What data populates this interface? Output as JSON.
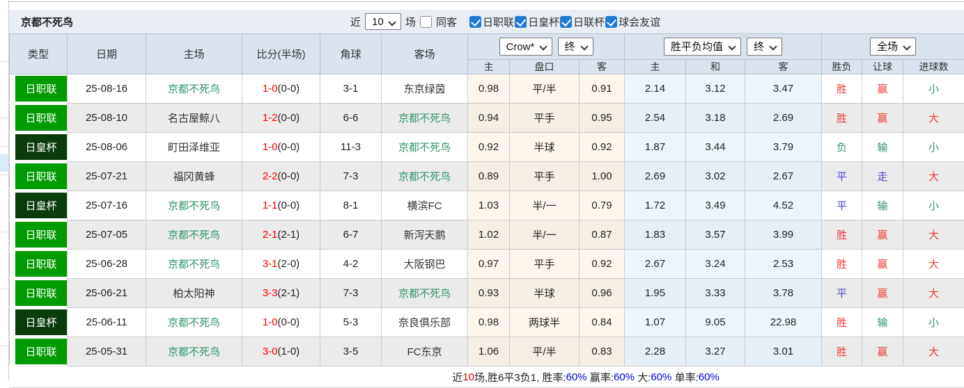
{
  "colors": {
    "accent_check": "#1f7ad4",
    "league_green": "#009b00",
    "cup_dark_green": "#0a3d0a",
    "self_team_green": "#2f9469",
    "score_red": "#ff0000",
    "win_red": "#f03b3b",
    "draw_blue": "#4a4ad4",
    "loss_green": "#2f9469",
    "footer_blue": "#0000dd"
  },
  "title": {
    "team": "京都不死鸟"
  },
  "filter_bar": {
    "near_label": "近",
    "matches_value": "10",
    "matches_label": "场",
    "same_away": {
      "label": "同客",
      "checked": false
    },
    "leagues": [
      {
        "label": "日职联",
        "checked": true
      },
      {
        "label": "日皇杯",
        "checked": true
      },
      {
        "label": "日联杯",
        "checked": true
      },
      {
        "label": "球会友谊",
        "checked": true
      }
    ]
  },
  "table": {
    "col_type": "类型",
    "col_date": "日期",
    "col_home": "主场",
    "col_score": "比分(半场)",
    "col_corner": "角球",
    "col_away": "客场",
    "odds_group": {
      "bookmaker_value": "Crow*",
      "time_value": "终",
      "sub": [
        "主",
        "盘口",
        "客"
      ]
    },
    "avg_group": {
      "name_value": "胜平负均值",
      "time_value": "终",
      "sub": [
        "主",
        "和",
        "客"
      ]
    },
    "result_group": {
      "scope_value": "全场",
      "sub": [
        "胜负",
        "让球",
        "进球数"
      ]
    },
    "rows": [
      {
        "league": "日职联",
        "league_tone": "jleague",
        "date": "25-08-16",
        "home": "京都不死鸟",
        "home_self": true,
        "score": "1-0",
        "half": "(0-0)",
        "corner": "3-1",
        "away": "东京绿茵",
        "away_self": false,
        "odds": [
          "0.98",
          "平/半",
          "0.91"
        ],
        "avg": [
          "2.14",
          "3.12",
          "3.47"
        ],
        "results": [
          {
            "text": "胜",
            "tone": "red"
          },
          {
            "text": "赢",
            "tone": "red"
          },
          {
            "text": "小",
            "tone": "green"
          }
        ]
      },
      {
        "league": "日职联",
        "league_tone": "jleague",
        "date": "25-08-10",
        "home": "名古屋鲸八",
        "home_self": false,
        "score": "1-2",
        "half": "(0-0)",
        "corner": "6-6",
        "away": "京都不死鸟",
        "away_self": true,
        "odds": [
          "0.94",
          "平手",
          "0.95"
        ],
        "avg": [
          "2.54",
          "3.18",
          "2.69"
        ],
        "results": [
          {
            "text": "胜",
            "tone": "red"
          },
          {
            "text": "赢",
            "tone": "red"
          },
          {
            "text": "大",
            "tone": "red"
          }
        ]
      },
      {
        "league": "日皇杯",
        "league_tone": "empcup",
        "date": "25-08-06",
        "home": "町田泽维亚",
        "home_self": false,
        "score": "1-0",
        "half": "(0-0)",
        "corner": "11-3",
        "away": "京都不死鸟",
        "away_self": true,
        "odds": [
          "0.92",
          "半球",
          "0.92"
        ],
        "avg": [
          "1.87",
          "3.44",
          "3.79"
        ],
        "results": [
          {
            "text": "负",
            "tone": "green"
          },
          {
            "text": "输",
            "tone": "green"
          },
          {
            "text": "小",
            "tone": "green"
          }
        ]
      },
      {
        "league": "日职联",
        "league_tone": "jleague",
        "date": "25-07-21",
        "home": "福冈黄蜂",
        "home_self": false,
        "score": "2-2",
        "half": "(0-0)",
        "corner": "7-3",
        "away": "京都不死鸟",
        "away_self": true,
        "odds": [
          "0.89",
          "平手",
          "1.00"
        ],
        "avg": [
          "2.69",
          "3.02",
          "2.67"
        ],
        "results": [
          {
            "text": "平",
            "tone": "blue"
          },
          {
            "text": "走",
            "tone": "blue"
          },
          {
            "text": "大",
            "tone": "red"
          }
        ]
      },
      {
        "league": "日皇杯",
        "league_tone": "empcup",
        "date": "25-07-16",
        "home": "京都不死鸟",
        "home_self": true,
        "score": "1-1",
        "half": "(0-0)",
        "corner": "8-1",
        "away": "横滨FC",
        "away_self": false,
        "odds": [
          "1.03",
          "半/一",
          "0.79"
        ],
        "avg": [
          "1.72",
          "3.49",
          "4.52"
        ],
        "results": [
          {
            "text": "平",
            "tone": "blue"
          },
          {
            "text": "输",
            "tone": "green"
          },
          {
            "text": "小",
            "tone": "green"
          }
        ]
      },
      {
        "league": "日职联",
        "league_tone": "jleague",
        "date": "25-07-05",
        "home": "京都不死鸟",
        "home_self": true,
        "score": "2-1",
        "half": "(2-1)",
        "corner": "6-7",
        "away": "新泻天鹅",
        "away_self": false,
        "odds": [
          "1.02",
          "半/一",
          "0.87"
        ],
        "avg": [
          "1.83",
          "3.57",
          "3.99"
        ],
        "results": [
          {
            "text": "胜",
            "tone": "red"
          },
          {
            "text": "赢",
            "tone": "red"
          },
          {
            "text": "大",
            "tone": "red"
          }
        ]
      },
      {
        "league": "日职联",
        "league_tone": "jleague",
        "date": "25-06-28",
        "home": "京都不死鸟",
        "home_self": true,
        "score": "3-1",
        "half": "(2-0)",
        "corner": "4-2",
        "away": "大阪钢巴",
        "away_self": false,
        "odds": [
          "0.97",
          "平手",
          "0.92"
        ],
        "avg": [
          "2.67",
          "3.24",
          "2.53"
        ],
        "results": [
          {
            "text": "胜",
            "tone": "red"
          },
          {
            "text": "赢",
            "tone": "red"
          },
          {
            "text": "大",
            "tone": "red"
          }
        ]
      },
      {
        "league": "日职联",
        "league_tone": "jleague",
        "date": "25-06-21",
        "home": "柏太阳神",
        "home_self": false,
        "score": "3-3",
        "half": "(2-1)",
        "corner": "7-3",
        "away": "京都不死鸟",
        "away_self": true,
        "odds": [
          "0.93",
          "半球",
          "0.96"
        ],
        "avg": [
          "1.95",
          "3.33",
          "3.78"
        ],
        "results": [
          {
            "text": "平",
            "tone": "blue"
          },
          {
            "text": "赢",
            "tone": "red"
          },
          {
            "text": "大",
            "tone": "red"
          }
        ]
      },
      {
        "league": "日皇杯",
        "league_tone": "empcup",
        "date": "25-06-11",
        "home": "京都不死鸟",
        "home_self": true,
        "score": "1-0",
        "half": "(0-0)",
        "corner": "5-3",
        "away": "奈良俱乐部",
        "away_self": false,
        "odds": [
          "0.98",
          "两球半",
          "0.84"
        ],
        "avg": [
          "1.07",
          "9.05",
          "22.98"
        ],
        "results": [
          {
            "text": "胜",
            "tone": "red"
          },
          {
            "text": "输",
            "tone": "green"
          },
          {
            "text": "小",
            "tone": "green"
          }
        ]
      },
      {
        "league": "日职联",
        "league_tone": "jleague",
        "date": "25-05-31",
        "home": "京都不死鸟",
        "home_self": true,
        "score": "3-0",
        "half": "(1-0)",
        "corner": "3-5",
        "away": "FC东京",
        "away_self": false,
        "odds": [
          "1.06",
          "平/半",
          "0.83"
        ],
        "avg": [
          "2.28",
          "3.27",
          "3.01"
        ],
        "results": [
          {
            "text": "胜",
            "tone": "red"
          },
          {
            "text": "赢",
            "tone": "red"
          },
          {
            "text": "大",
            "tone": "red"
          }
        ]
      }
    ]
  },
  "footer": {
    "segments": [
      {
        "text": "近",
        "tone": "dark"
      },
      {
        "text": "10",
        "tone": "red"
      },
      {
        "text": "场,胜6平3负1, 胜率:",
        "tone": "dark"
      },
      {
        "text": "60%",
        "tone": "blue"
      },
      {
        "text": " 赢率:",
        "tone": "dark"
      },
      {
        "text": "60%",
        "tone": "blue"
      },
      {
        "text": " 大:",
        "tone": "dark"
      },
      {
        "text": "60%",
        "tone": "blue"
      },
      {
        "text": " 单率:",
        "tone": "dark"
      },
      {
        "text": "60%",
        "tone": "blue"
      }
    ]
  }
}
